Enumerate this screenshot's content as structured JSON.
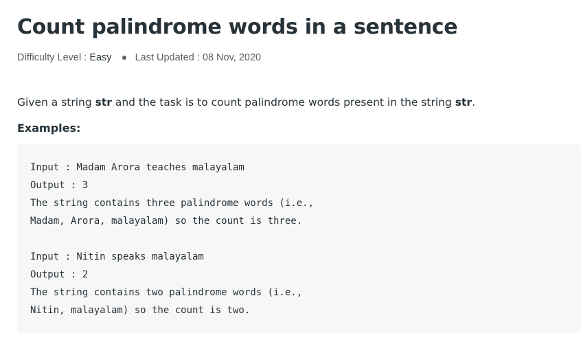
{
  "article": {
    "title": "Count palindrome words in a sentence",
    "meta": {
      "difficulty_label": "Difficulty Level : ",
      "difficulty_value": "Easy",
      "updated_text": "Last Updated : 08 Nov, 2020"
    },
    "intro": {
      "part1": "Given a string ",
      "bold1": "str",
      "part2": " and the task is to count palindrome words present in the string ",
      "bold2": "str",
      "part3": "."
    },
    "examples_heading": "Examples:",
    "code_lines": [
      "Input : Madam Arora teaches malayalam",
      "Output : 3",
      "The string contains three palindrome words (i.e.,",
      "Madam, Arora, malayalam) so the count is three.",
      "",
      "Input : Nitin speaks malayalam",
      "Output : 2",
      "The string contains two palindrome words (i.e.,",
      "Nitin, malayalam) so the count is two."
    ]
  }
}
